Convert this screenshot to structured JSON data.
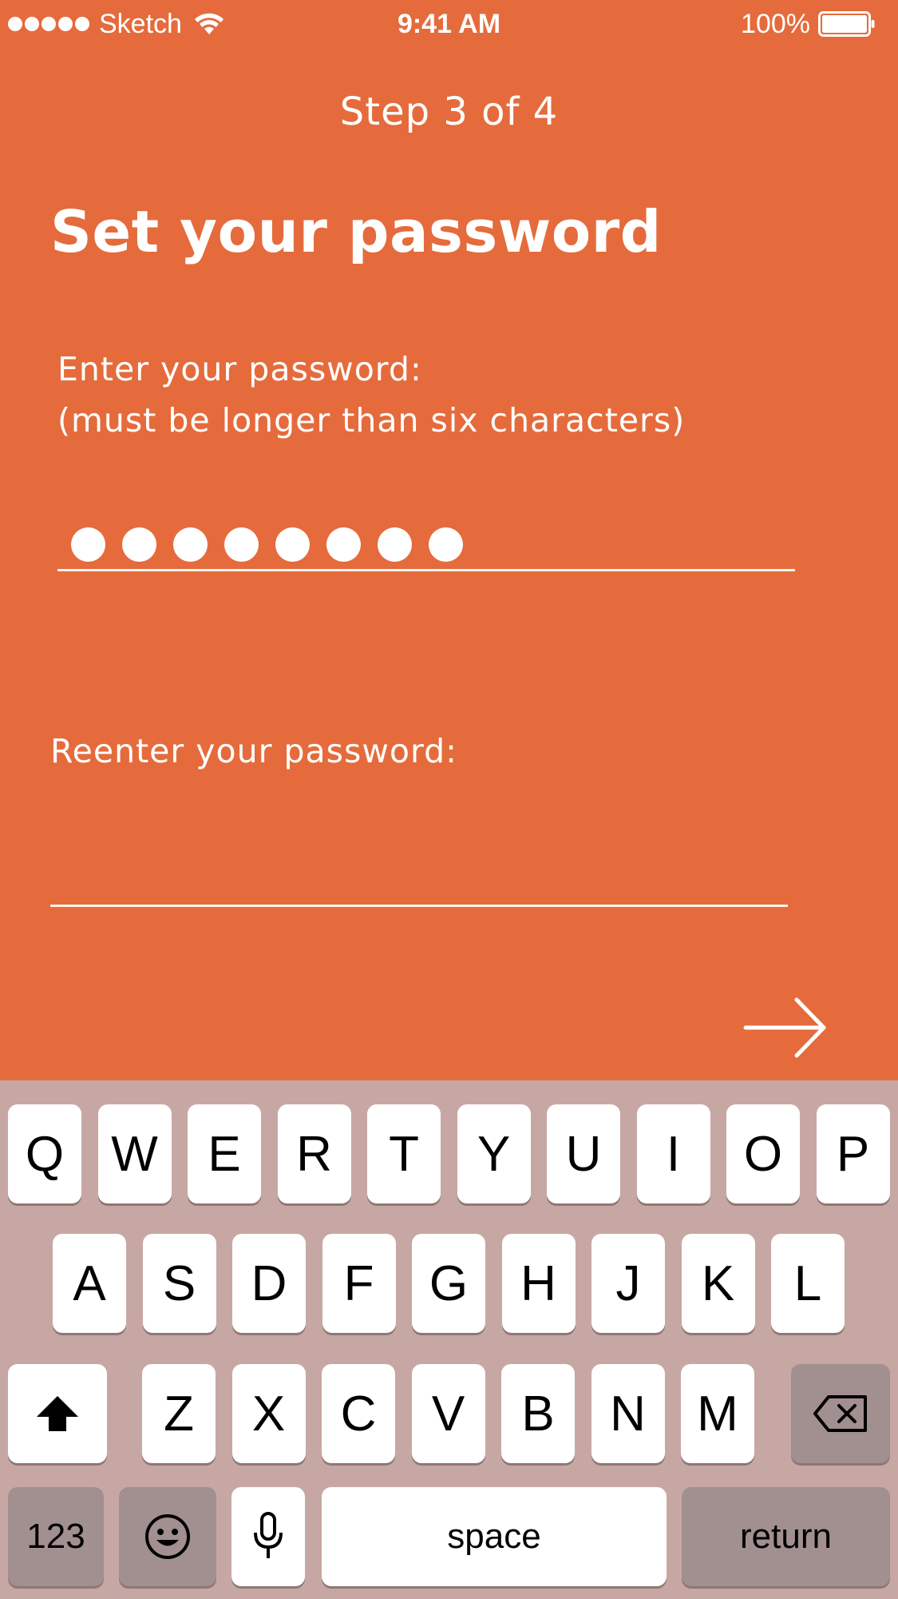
{
  "status_bar": {
    "carrier": "Sketch",
    "time": "9:41 AM",
    "battery": "100%",
    "icons": [
      "signal-dots-icon",
      "wifi-icon",
      "battery-icon"
    ]
  },
  "header": {
    "step": "Step 3 of 4",
    "title": "Set your password"
  },
  "form": {
    "password_label_line1": "Enter your password:",
    "password_label_line2": "(must be longer than six characters)",
    "password_masked_length": 8,
    "reenter_label": "Reenter your password:",
    "reenter_value": ""
  },
  "next": {
    "icon": "arrow-right-icon"
  },
  "keyboard": {
    "row1": [
      "Q",
      "W",
      "E",
      "R",
      "T",
      "Y",
      "U",
      "I",
      "O",
      "P"
    ],
    "row2": [
      "A",
      "S",
      "D",
      "F",
      "G",
      "H",
      "J",
      "K",
      "L"
    ],
    "row3": [
      "Z",
      "X",
      "C",
      "V",
      "B",
      "N",
      "M"
    ],
    "numbers_label": "123",
    "space_label": "space",
    "return_label": "return",
    "icons": [
      "shift-icon",
      "delete-icon",
      "emoji-icon",
      "microphone-icon"
    ]
  },
  "colors": {
    "background": "#E56B3C",
    "keyboard_background": "#C7A7A4",
    "function_key": "#A28F90",
    "text": "#FFFFFF"
  }
}
